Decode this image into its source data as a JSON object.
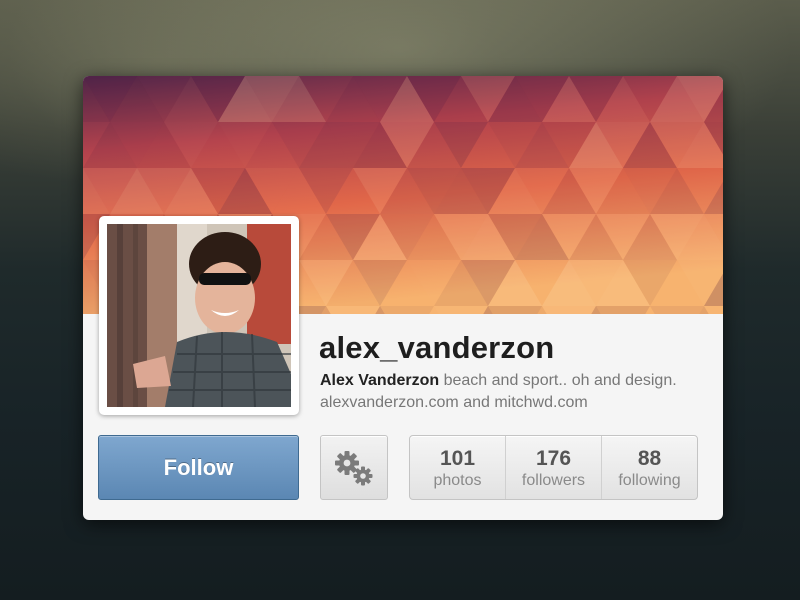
{
  "profile": {
    "username": "alex_vanderzon",
    "display_name": "Alex Vanderzon",
    "bio": "beach and sport.. oh and design. alexvanderzon.com and mitchwd.com"
  },
  "actions": {
    "follow_label": "Follow",
    "settings_icon": "gears-icon"
  },
  "stats": [
    {
      "count": "101",
      "label": "photos"
    },
    {
      "count": "176",
      "label": "followers"
    },
    {
      "count": "88",
      "label": "following"
    }
  ],
  "colors": {
    "follow_button": "#6b96c2",
    "cover_gradient_top": "#5a2a4a",
    "cover_gradient_bottom": "#f6b26b"
  }
}
